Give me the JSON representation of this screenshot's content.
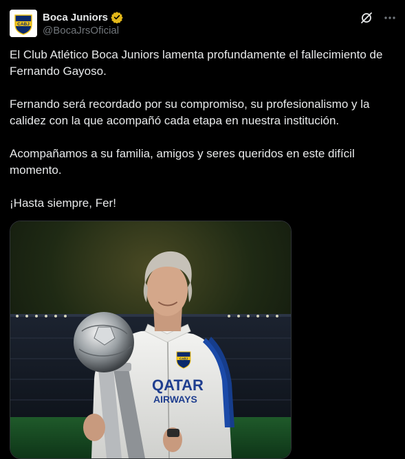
{
  "author": {
    "display_name": "Boca Juniors",
    "handle": "@BocaJrsOficial",
    "avatar_text": "CABJ",
    "verified": true
  },
  "icons": {
    "verified": "verified-badge-icon",
    "grok": "grok-icon",
    "more": "more-options-icon"
  },
  "post": {
    "paragraphs": [
      "El Club Atlético Boca Juniors lamenta profundamente el fallecimiento de Fernando Gayoso.",
      "Fernando será recordado por su compromiso, su profesionalismo y la calidez con la que acompañó cada etapa en nuestra institución.",
      "Acompañamos a su familia, amigos y seres queridos en este difícil momento.",
      "¡Hasta siempre, Fer!"
    ]
  },
  "media": {
    "jacket_sponsor_line1": "QATAR",
    "jacket_sponsor_line2": "AIRWAYS",
    "crest_text": "CABJ"
  },
  "colors": {
    "background": "#000000",
    "text": "#e7e9ea",
    "secondary": "#71767b",
    "verified_gold": "#e2b719",
    "boca_blue": "#0b2a6b",
    "boca_gold": "#f5c518"
  }
}
